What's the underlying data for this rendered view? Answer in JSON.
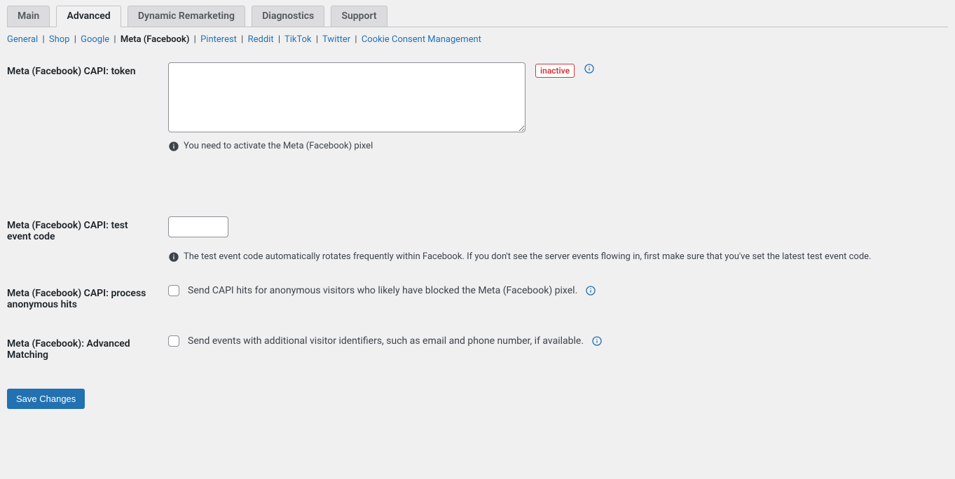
{
  "tabs": [
    {
      "label": "Main",
      "active": false
    },
    {
      "label": "Advanced",
      "active": true
    },
    {
      "label": "Dynamic Remarketing",
      "active": false
    },
    {
      "label": "Diagnostics",
      "active": false
    },
    {
      "label": "Support",
      "active": false
    }
  ],
  "subnav": [
    {
      "label": "General",
      "active": false
    },
    {
      "label": "Shop",
      "active": false
    },
    {
      "label": "Google",
      "active": false
    },
    {
      "label": "Meta (Facebook)",
      "active": true
    },
    {
      "label": "Pinterest",
      "active": false
    },
    {
      "label": "Reddit",
      "active": false
    },
    {
      "label": "TikTok",
      "active": false
    },
    {
      "label": "Twitter",
      "active": false
    },
    {
      "label": "Cookie Consent Management",
      "active": false
    }
  ],
  "fields": {
    "capi_token": {
      "label": "Meta (Facebook) CAPI: token",
      "value": "",
      "status_badge": "inactive",
      "helper": "You need to activate the Meta (Facebook) pixel"
    },
    "capi_test_event": {
      "label": "Meta (Facebook) CAPI: test event code",
      "value": "",
      "helper": "The test event code automatically rotates frequently within Facebook. If you don't see the server events flowing in, first make sure that you've set the latest test event code."
    },
    "capi_anonymous": {
      "label": "Meta (Facebook) CAPI: process anonymous hits",
      "checkbox_label": "Send CAPI hits for anonymous visitors who likely have blocked the Meta (Facebook) pixel.",
      "checked": false
    },
    "advanced_matching": {
      "label": "Meta (Facebook): Advanced Matching",
      "checkbox_label": "Send events with additional visitor identifiers, such as email and phone number, if available.",
      "checked": false
    }
  },
  "buttons": {
    "save": "Save Changes"
  },
  "icons": {
    "info_outline": "info-icon",
    "info_solid": "info-solid-icon"
  }
}
